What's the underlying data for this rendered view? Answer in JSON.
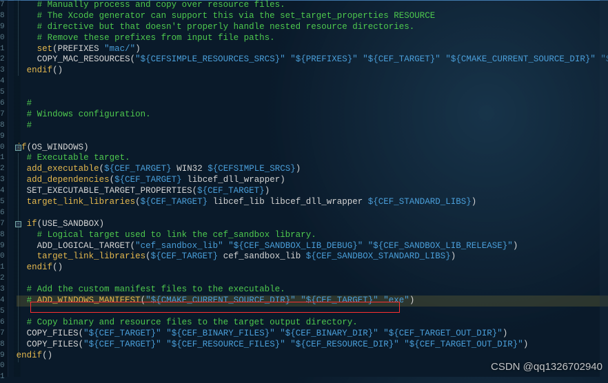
{
  "watermark": "CSDN @qq1326702940",
  "gutter_start_digits": [
    "7",
    "8",
    "9",
    "0",
    "1",
    "2",
    "3",
    "4",
    "5",
    "6",
    "7",
    "8",
    "9",
    "0",
    "1",
    "2",
    "3",
    "4",
    "5",
    "6",
    "7",
    "8",
    "9",
    "0",
    "1",
    "2",
    "3",
    "4",
    "5",
    "6",
    "7",
    "8",
    "9",
    "0",
    "1"
  ],
  "lines": [
    {
      "indent": "    ",
      "segs": [
        {
          "cls": "c-comment",
          "t": "# Manually process and copy over resource files."
        }
      ]
    },
    {
      "indent": "    ",
      "segs": [
        {
          "cls": "c-comment",
          "t": "# The Xcode generator can support this via the set_target_properties RESOURCE"
        }
      ]
    },
    {
      "indent": "    ",
      "segs": [
        {
          "cls": "c-comment",
          "t": "# directive but that doesn't properly handle nested resource directories."
        }
      ]
    },
    {
      "indent": "    ",
      "segs": [
        {
          "cls": "c-comment",
          "t": "# Remove these prefixes from input file paths."
        }
      ]
    },
    {
      "indent": "    ",
      "segs": [
        {
          "cls": "c-func",
          "t": "set"
        },
        {
          "cls": "c-paren",
          "t": "("
        },
        {
          "cls": "c-plain",
          "t": "PREFIXES "
        },
        {
          "cls": "c-string",
          "t": "\"mac/\""
        },
        {
          "cls": "c-paren",
          "t": ")"
        }
      ]
    },
    {
      "indent": "    ",
      "segs": [
        {
          "cls": "c-plain",
          "t": "COPY_MAC_RESOURCES("
        },
        {
          "cls": "c-string",
          "t": "\"${CEFSIMPLE_RESOURCES_SRCS}\""
        },
        {
          "cls": "c-plain",
          "t": " "
        },
        {
          "cls": "c-string",
          "t": "\"${PREFIXES}\""
        },
        {
          "cls": "c-plain",
          "t": " "
        },
        {
          "cls": "c-string",
          "t": "\"${CEF_TARGET}\""
        },
        {
          "cls": "c-plain",
          "t": " "
        },
        {
          "cls": "c-string",
          "t": "\"${CMAKE_CURRENT_SOURCE_DIR}\""
        },
        {
          "cls": "c-plain",
          "t": " "
        },
        {
          "cls": "c-string",
          "t": "\"${CEF_APP}\""
        },
        {
          "cls": "c-paren",
          "t": ")"
        }
      ]
    },
    {
      "indent": "  ",
      "segs": [
        {
          "cls": "c-func",
          "t": "endif"
        },
        {
          "cls": "c-paren",
          "t": "()"
        }
      ]
    },
    {
      "indent": "",
      "segs": [
        {
          "cls": "c-plain",
          "t": ""
        }
      ]
    },
    {
      "indent": "",
      "segs": [
        {
          "cls": "c-plain",
          "t": ""
        }
      ]
    },
    {
      "indent": "  ",
      "segs": [
        {
          "cls": "c-comment",
          "t": "#"
        }
      ]
    },
    {
      "indent": "  ",
      "segs": [
        {
          "cls": "c-comment",
          "t": "# Windows configuration."
        }
      ]
    },
    {
      "indent": "  ",
      "segs": [
        {
          "cls": "c-comment",
          "t": "#"
        }
      ]
    },
    {
      "indent": "",
      "segs": [
        {
          "cls": "c-plain",
          "t": ""
        }
      ]
    },
    {
      "indent": "",
      "segs": [
        {
          "cls": "c-func",
          "t": "if"
        },
        {
          "cls": "c-paren",
          "t": "("
        },
        {
          "cls": "c-plain",
          "t": "OS_WINDOWS"
        },
        {
          "cls": "c-paren",
          "t": ")"
        }
      ]
    },
    {
      "indent": "  ",
      "segs": [
        {
          "cls": "c-comment",
          "t": "# Executable target."
        }
      ]
    },
    {
      "indent": "  ",
      "segs": [
        {
          "cls": "c-func",
          "t": "add_executable"
        },
        {
          "cls": "c-paren",
          "t": "("
        },
        {
          "cls": "c-var",
          "t": "${CEF_TARGET}"
        },
        {
          "cls": "c-plain",
          "t": " WIN32 "
        },
        {
          "cls": "c-var",
          "t": "${CEFSIMPLE_SRCS}"
        },
        {
          "cls": "c-paren",
          "t": ")"
        }
      ]
    },
    {
      "indent": "  ",
      "segs": [
        {
          "cls": "c-func",
          "t": "add_dependencies"
        },
        {
          "cls": "c-paren",
          "t": "("
        },
        {
          "cls": "c-var",
          "t": "${CEF_TARGET}"
        },
        {
          "cls": "c-plain",
          "t": " libcef_dll_wrapper"
        },
        {
          "cls": "c-paren",
          "t": ")"
        }
      ]
    },
    {
      "indent": "  ",
      "segs": [
        {
          "cls": "c-plain",
          "t": "SET_EXECUTABLE_TARGET_PROPERTIES("
        },
        {
          "cls": "c-var",
          "t": "${CEF_TARGET}"
        },
        {
          "cls": "c-paren",
          "t": ")"
        }
      ]
    },
    {
      "indent": "  ",
      "segs": [
        {
          "cls": "c-func",
          "t": "target_link_libraries"
        },
        {
          "cls": "c-paren",
          "t": "("
        },
        {
          "cls": "c-var",
          "t": "${CEF_TARGET}"
        },
        {
          "cls": "c-plain",
          "t": " libcef_lib libcef_dll_wrapper "
        },
        {
          "cls": "c-var",
          "t": "${CEF_STANDARD_LIBS}"
        },
        {
          "cls": "c-paren",
          "t": ")"
        }
      ]
    },
    {
      "indent": "",
      "segs": [
        {
          "cls": "c-plain",
          "t": ""
        }
      ]
    },
    {
      "indent": "  ",
      "segs": [
        {
          "cls": "c-func",
          "t": "if"
        },
        {
          "cls": "c-paren",
          "t": "("
        },
        {
          "cls": "c-plain",
          "t": "USE_SANDBOX"
        },
        {
          "cls": "c-paren",
          "t": ")"
        }
      ]
    },
    {
      "indent": "    ",
      "segs": [
        {
          "cls": "c-comment",
          "t": "# Logical target used to link the cef_sandbox library."
        }
      ]
    },
    {
      "indent": "    ",
      "segs": [
        {
          "cls": "c-plain",
          "t": "ADD_LOGICAL_TARGET("
        },
        {
          "cls": "c-string",
          "t": "\"cef_sandbox_lib\""
        },
        {
          "cls": "c-plain",
          "t": " "
        },
        {
          "cls": "c-string",
          "t": "\"${CEF_SANDBOX_LIB_DEBUG}\""
        },
        {
          "cls": "c-plain",
          "t": " "
        },
        {
          "cls": "c-string",
          "t": "\"${CEF_SANDBOX_LIB_RELEASE}\""
        },
        {
          "cls": "c-paren",
          "t": ")"
        }
      ]
    },
    {
      "indent": "    ",
      "segs": [
        {
          "cls": "c-func",
          "t": "target_link_libraries"
        },
        {
          "cls": "c-paren",
          "t": "("
        },
        {
          "cls": "c-var",
          "t": "${CEF_TARGET}"
        },
        {
          "cls": "c-plain",
          "t": " cef_sandbox_lib "
        },
        {
          "cls": "c-var",
          "t": "${CEF_SANDBOX_STANDARD_LIBS}"
        },
        {
          "cls": "c-paren",
          "t": ")"
        }
      ]
    },
    {
      "indent": "  ",
      "segs": [
        {
          "cls": "c-func",
          "t": "endif"
        },
        {
          "cls": "c-paren",
          "t": "()"
        }
      ]
    },
    {
      "indent": "",
      "segs": [
        {
          "cls": "c-plain",
          "t": ""
        }
      ]
    },
    {
      "indent": "  ",
      "segs": [
        {
          "cls": "c-comment",
          "t": "# Add the custom manifest files to the executable."
        }
      ]
    },
    {
      "indent": "  ",
      "hl": true,
      "segs": [
        {
          "cls": "c-comment",
          "t": "# "
        },
        {
          "cls": "c-keyword",
          "t": "ADD_WINDOWS_MANIFEST"
        },
        {
          "cls": "c-paren",
          "t": "("
        },
        {
          "cls": "c-string",
          "t": "\"${CMAKE_CURRENT_SOURCE_DIR}\""
        },
        {
          "cls": "c-plain",
          "t": " "
        },
        {
          "cls": "c-string",
          "t": "\"${CEF_TARGET}\""
        },
        {
          "cls": "c-plain",
          "t": " "
        },
        {
          "cls": "c-string",
          "t": "\"exe\""
        },
        {
          "cls": "c-paren",
          "t": ")"
        }
      ]
    },
    {
      "indent": "",
      "segs": [
        {
          "cls": "c-plain",
          "t": ""
        }
      ]
    },
    {
      "indent": "  ",
      "segs": [
        {
          "cls": "c-comment",
          "t": "# Copy binary and resource files to the target output directory."
        }
      ]
    },
    {
      "indent": "  ",
      "segs": [
        {
          "cls": "c-plain",
          "t": "COPY_FILES("
        },
        {
          "cls": "c-string",
          "t": "\"${CEF_TARGET}\""
        },
        {
          "cls": "c-plain",
          "t": " "
        },
        {
          "cls": "c-string",
          "t": "\"${CEF_BINARY_FILES}\""
        },
        {
          "cls": "c-plain",
          "t": " "
        },
        {
          "cls": "c-string",
          "t": "\"${CEF_BINARY_DIR}\""
        },
        {
          "cls": "c-plain",
          "t": " "
        },
        {
          "cls": "c-string",
          "t": "\"${CEF_TARGET_OUT_DIR}\""
        },
        {
          "cls": "c-paren",
          "t": ")"
        }
      ]
    },
    {
      "indent": "  ",
      "segs": [
        {
          "cls": "c-plain",
          "t": "COPY_FILES("
        },
        {
          "cls": "c-string",
          "t": "\"${CEF_TARGET}\""
        },
        {
          "cls": "c-plain",
          "t": " "
        },
        {
          "cls": "c-string",
          "t": "\"${CEF_RESOURCE_FILES}\""
        },
        {
          "cls": "c-plain",
          "t": " "
        },
        {
          "cls": "c-string",
          "t": "\"${CEF_RESOURCE_DIR}\""
        },
        {
          "cls": "c-plain",
          "t": " "
        },
        {
          "cls": "c-string",
          "t": "\"${CEF_TARGET_OUT_DIR}\""
        },
        {
          "cls": "c-paren",
          "t": ")"
        }
      ]
    },
    {
      "indent": "",
      "segs": [
        {
          "cls": "c-func",
          "t": "endif"
        },
        {
          "cls": "c-paren",
          "t": "()"
        }
      ]
    }
  ],
  "fold_markers": [
    {
      "line": 13,
      "symbol": "-"
    },
    {
      "line": 20,
      "symbol": "-"
    }
  ]
}
